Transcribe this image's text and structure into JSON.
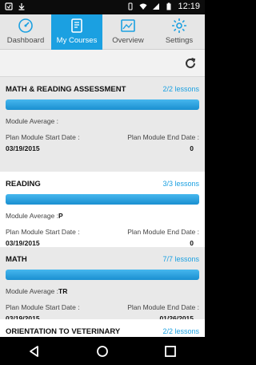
{
  "status": {
    "time": "12:19"
  },
  "tabs": [
    {
      "label": "Dashboard",
      "icon": "dashboard-icon"
    },
    {
      "label": "My Courses",
      "icon": "courses-icon",
      "active": true
    },
    {
      "label": "Overview",
      "icon": "overview-icon"
    },
    {
      "label": "Settings",
      "icon": "gear-icon"
    }
  ],
  "courses": [
    {
      "title": "MATH & READING ASSESSMENT",
      "lessons": "2/2 lessons",
      "avg_label": "Module Average :",
      "avg_value": "",
      "start_label": "Plan Module Start Date :",
      "end_label": "Plan Module End Date :",
      "start": "03/19/2015",
      "end": "0"
    },
    {
      "title": "READING",
      "lessons": "3/3 lessons",
      "avg_label": "Module Average :",
      "avg_value": "P",
      "start_label": "Plan Module Start Date :",
      "end_label": "Plan Module End Date :",
      "start": "03/19/2015",
      "end": "0"
    },
    {
      "title": "MATH",
      "lessons": "7/7 lessons",
      "avg_label": "Module Average :",
      "avg_value": "TR",
      "start_label": "Plan Module Start Date :",
      "end_label": "Plan Module End Date :",
      "start": "03/19/2015",
      "end": "01/26/2015"
    },
    {
      "title": "ORIENTATION TO VETERINARY TECHNOLOGY",
      "lessons": "2/2 lessons"
    }
  ],
  "colors": {
    "accent": "#1ba0e1",
    "tab_bg": "#e6e6e6",
    "row_alt": "#e9e9e9"
  }
}
